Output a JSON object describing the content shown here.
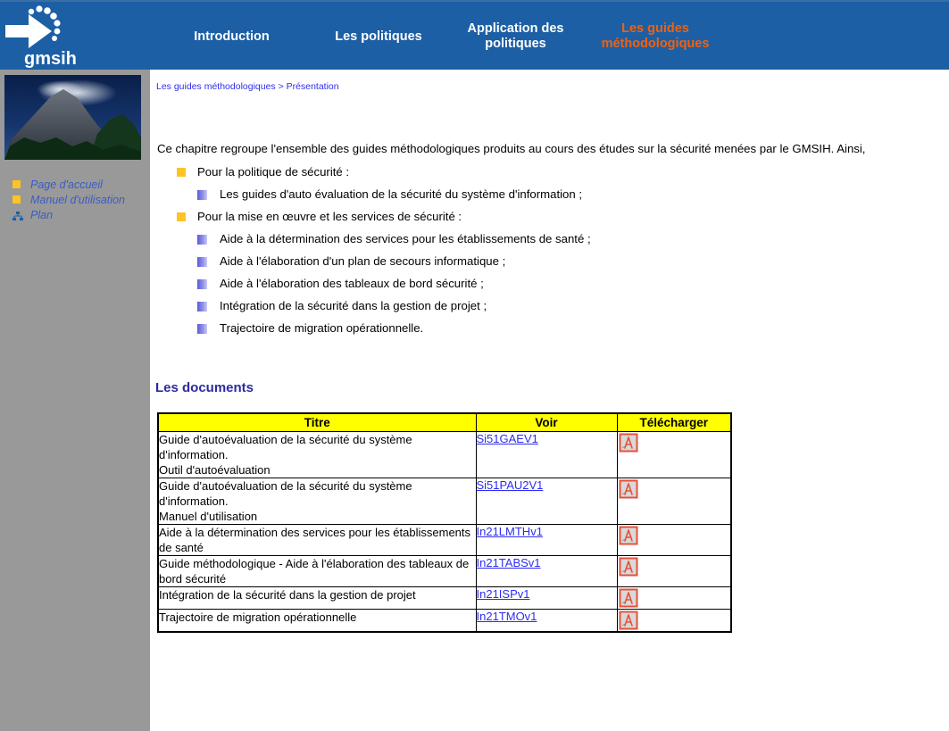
{
  "site": {
    "logo_text": "gmsih",
    "header_bg": "#1c5fa5",
    "accent_active": "#f2600c",
    "sidebar_bg": "#999999",
    "link_blue": "#2d2df0",
    "heading_blue": "#2b2ba0",
    "bullet_yellow": "#ffc423",
    "table_header_yellow": "#ffff00"
  },
  "nav": {
    "items": [
      {
        "label": "Introduction",
        "active": false
      },
      {
        "label": "Les politiques",
        "active": false
      },
      {
        "label": "Application des politiques",
        "active": false
      },
      {
        "label": "Les guides méthodologiques",
        "active": true
      }
    ]
  },
  "sidebar": {
    "photo_alt": "volcan",
    "links": [
      {
        "label": "Page d'accueil",
        "icon": "yellow-square-icon"
      },
      {
        "label": "Manuel d'utilisation",
        "icon": "yellow-square-icon"
      },
      {
        "label": "Plan",
        "icon": "sitemap-icon"
      }
    ]
  },
  "breadcrumb": {
    "root": "Les guides méthodologiques",
    "separator": " > ",
    "current": "Présentation"
  },
  "main": {
    "intro": "Ce chapitre regroupe l'ensemble des guides méthodologiques produits au cours des études sur la sécurité menées par le GMSIH. Ainsi,",
    "bullets": [
      {
        "level": 1,
        "text": "Pour la politique de sécurité :"
      },
      {
        "level": 2,
        "text": "Les guides d'auto évaluation de la sécurité du système d'information ;"
      },
      {
        "level": 1,
        "text": "Pour la mise en œuvre et les services de sécurité :"
      },
      {
        "level": 2,
        "text": "Aide à la détermination des services pour les établissements de santé ;"
      },
      {
        "level": 2,
        "text": "Aide à l'élaboration d'un plan de secours informatique ;"
      },
      {
        "level": 2,
        "text": "Aide à l'élaboration des tableaux de bord sécurité ;"
      },
      {
        "level": 2,
        "text": "Intégration de la sécurité dans la gestion de projet ;"
      },
      {
        "level": 2,
        "text": "Trajectoire de migration opérationnelle."
      }
    ],
    "section_heading": "Les documents",
    "table": {
      "headers": [
        "Titre",
        "Voir",
        "Télécharger"
      ],
      "rows": [
        {
          "title": "Guide d'autoévaluation de la sécurité du système d'information.\nOutil d'autoévaluation",
          "voir": "Si51GAEV1",
          "download_icon": "pdf-icon"
        },
        {
          "title": "Guide d'autoévaluation de la sécurité du système d'information.\nManuel d'utilisation",
          "voir": "Si51PAU2V1",
          "download_icon": "pdf-icon"
        },
        {
          "title": "Aide à la détermination des services pour les établissements de santé",
          "voir": "In21LMTHv1",
          "download_icon": "pdf-icon"
        },
        {
          "title": "Guide méthodologique - Aide à l'élaboration des tableaux de bord sécurité",
          "voir": "In21TABSv1",
          "download_icon": "pdf-icon"
        },
        {
          "title": "Intégration de la sécurité dans la gestion de projet",
          "voir": "In21ISPv1",
          "download_icon": "pdf-icon"
        },
        {
          "title": "Trajectoire de migration opérationnelle",
          "voir": "In21TMOv1",
          "download_icon": "pdf-icon"
        }
      ]
    }
  }
}
